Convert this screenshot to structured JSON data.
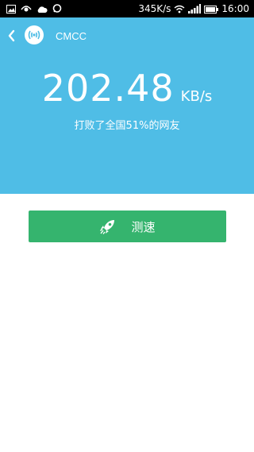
{
  "status_bar": {
    "net_speed": "345K/s",
    "time": "16:00",
    "icons": [
      "image-icon",
      "eye-icon",
      "cloud-icon",
      "chat-icon",
      "wifi-icon",
      "signal-icon",
      "battery-icon"
    ]
  },
  "header": {
    "network_name": "CMCC",
    "icons": [
      "back-arrow-icon",
      "wifi-hotspot-icon"
    ]
  },
  "result": {
    "speed_value": "202.48",
    "speed_unit": "KB/s",
    "note": "打败了全国51%的网友"
  },
  "action": {
    "test_label": "测速",
    "icon": "rocket-icon"
  },
  "colors": {
    "hero_bg": "#4fbde6",
    "button_bg": "#35b46e"
  }
}
